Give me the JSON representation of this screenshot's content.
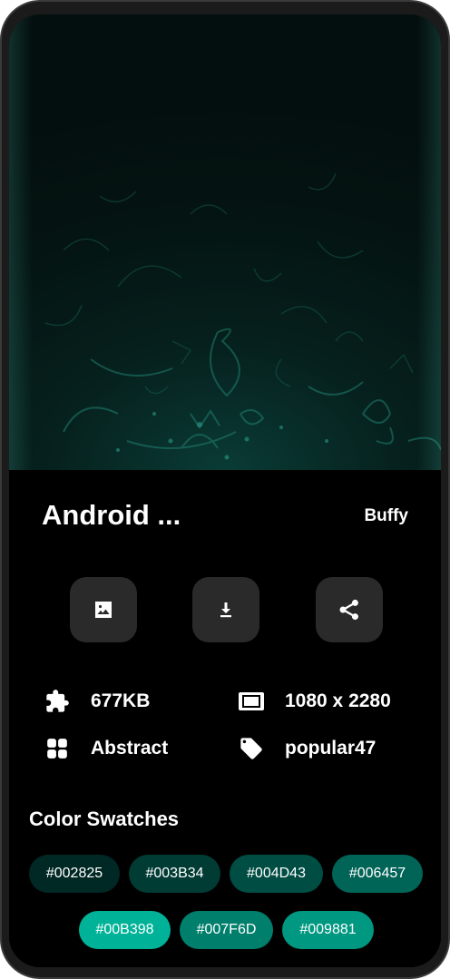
{
  "wallpaper": {
    "name": "Android ...",
    "author": "Buffy"
  },
  "actions": [
    {
      "label": "Set wallpaper",
      "icon": "image-icon"
    },
    {
      "label": "Download",
      "icon": "download-icon"
    },
    {
      "label": "Share",
      "icon": "share-icon"
    }
  ],
  "details": {
    "size": "677KB",
    "resolution": "1080 x 2280",
    "category": "Abstract",
    "tag": "popular47"
  },
  "swatches_title": "Color Swatches",
  "swatches": [
    {
      "label": "#002825",
      "color": "#002825"
    },
    {
      "label": "#003B34",
      "color": "#003B34"
    },
    {
      "label": "#004D43",
      "color": "#004D43"
    },
    {
      "label": "#006457",
      "color": "#006457"
    },
    {
      "label": "#00B398",
      "color": "#00B398"
    },
    {
      "label": "#007F6D",
      "color": "#007F6D"
    },
    {
      "label": "#009881",
      "color": "#009881"
    }
  ]
}
